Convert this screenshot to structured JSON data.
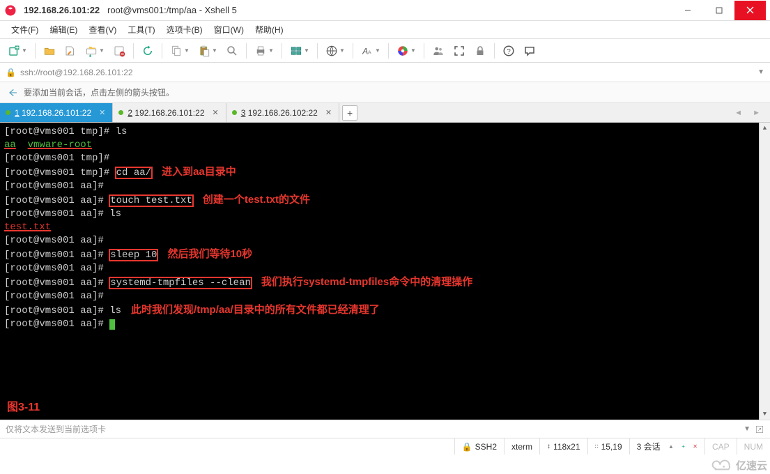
{
  "window": {
    "title_ip": "192.168.26.101:22",
    "title_rest": "root@vms001:/tmp/aa - Xshell 5"
  },
  "menu": {
    "file": "文件(F)",
    "edit": "编辑(E)",
    "view": "查看(V)",
    "tools": "工具(T)",
    "tabs": "选项卡(B)",
    "window": "窗口(W)",
    "help": "帮助(H)"
  },
  "addressbar": {
    "url": "ssh://root@192.168.26.101:22"
  },
  "infobar": {
    "text": "要添加当前会话，点击左侧的箭头按钮。"
  },
  "tabs": [
    {
      "num": "1",
      "label": "192.168.26.101:22",
      "active": true
    },
    {
      "num": "2",
      "label": "192.168.26.101:22",
      "active": false
    },
    {
      "num": "3",
      "label": "192.168.26.102:22",
      "active": false
    }
  ],
  "terminal": {
    "lines": [
      {
        "segs": [
          {
            "t": "[root@vms001 tmp]# ",
            "c": "wht"
          },
          {
            "t": "ls",
            "c": "wht"
          }
        ]
      },
      {
        "segs": [
          {
            "t": "aa",
            "c": "green",
            "ul": true
          },
          {
            "t": "  ",
            "c": "wht"
          },
          {
            "t": "vmware-root",
            "c": "green",
            "ul": true
          }
        ]
      },
      {
        "segs": [
          {
            "t": "[root@vms001 tmp]#",
            "c": "wht"
          }
        ]
      },
      {
        "segs": [
          {
            "t": "[root@vms001 tmp]# ",
            "c": "wht"
          },
          {
            "t": "cd aa/",
            "c": "wht",
            "box": true
          }
        ],
        "annot": "进入到aa目录中"
      },
      {
        "segs": [
          {
            "t": "[root@vms001 aa]#",
            "c": "wht"
          }
        ]
      },
      {
        "segs": [
          {
            "t": "[root@vms001 aa]# ",
            "c": "wht"
          },
          {
            "t": "touch test.txt",
            "c": "wht",
            "box": true
          }
        ],
        "annot": "创建一个test.txt的文件"
      },
      {
        "segs": [
          {
            "t": "[root@vms001 aa]# ",
            "c": "wht"
          },
          {
            "t": "ls",
            "c": "wht"
          }
        ]
      },
      {
        "segs": [
          {
            "t": "test.txt",
            "c": "red",
            "ul": true
          }
        ]
      },
      {
        "segs": [
          {
            "t": "[root@vms001 aa]#",
            "c": "wht"
          }
        ]
      },
      {
        "segs": [
          {
            "t": "[root@vms001 aa]# ",
            "c": "wht"
          },
          {
            "t": "sleep 10",
            "c": "wht",
            "box": true
          }
        ],
        "annot": "然后我们等待10秒"
      },
      {
        "segs": [
          {
            "t": "[root@vms001 aa]#",
            "c": "wht"
          }
        ]
      },
      {
        "segs": [
          {
            "t": "[root@vms001 aa]# ",
            "c": "wht"
          },
          {
            "t": "systemd-tmpfiles --clean",
            "c": "wht",
            "box": true
          }
        ],
        "annot": "我们执行systemd-tmpfiles命令中的清理操作"
      },
      {
        "segs": [
          {
            "t": "[root@vms001 aa]#",
            "c": "wht"
          }
        ]
      },
      {
        "segs": [
          {
            "t": "[root@vms001 aa]# ",
            "c": "wht"
          },
          {
            "t": "ls",
            "c": "wht"
          }
        ],
        "annot": "此时我们发现/tmp/aa/目录中的所有文件都已经清理了"
      },
      {
        "segs": [
          {
            "t": "[root@vms001 aa]# ",
            "c": "wht"
          }
        ],
        "cursor": true
      }
    ],
    "figure_label": "图3-11"
  },
  "sendbar": {
    "placeholder": "仅将文本发送到当前选项卡"
  },
  "status": {
    "proto": "SSH2",
    "term": "xterm",
    "size": "118x21",
    "pos": "15,19",
    "sessions": "3 会话",
    "cap": "CAP",
    "num": "NUM"
  },
  "watermark": {
    "text": "亿速云"
  }
}
